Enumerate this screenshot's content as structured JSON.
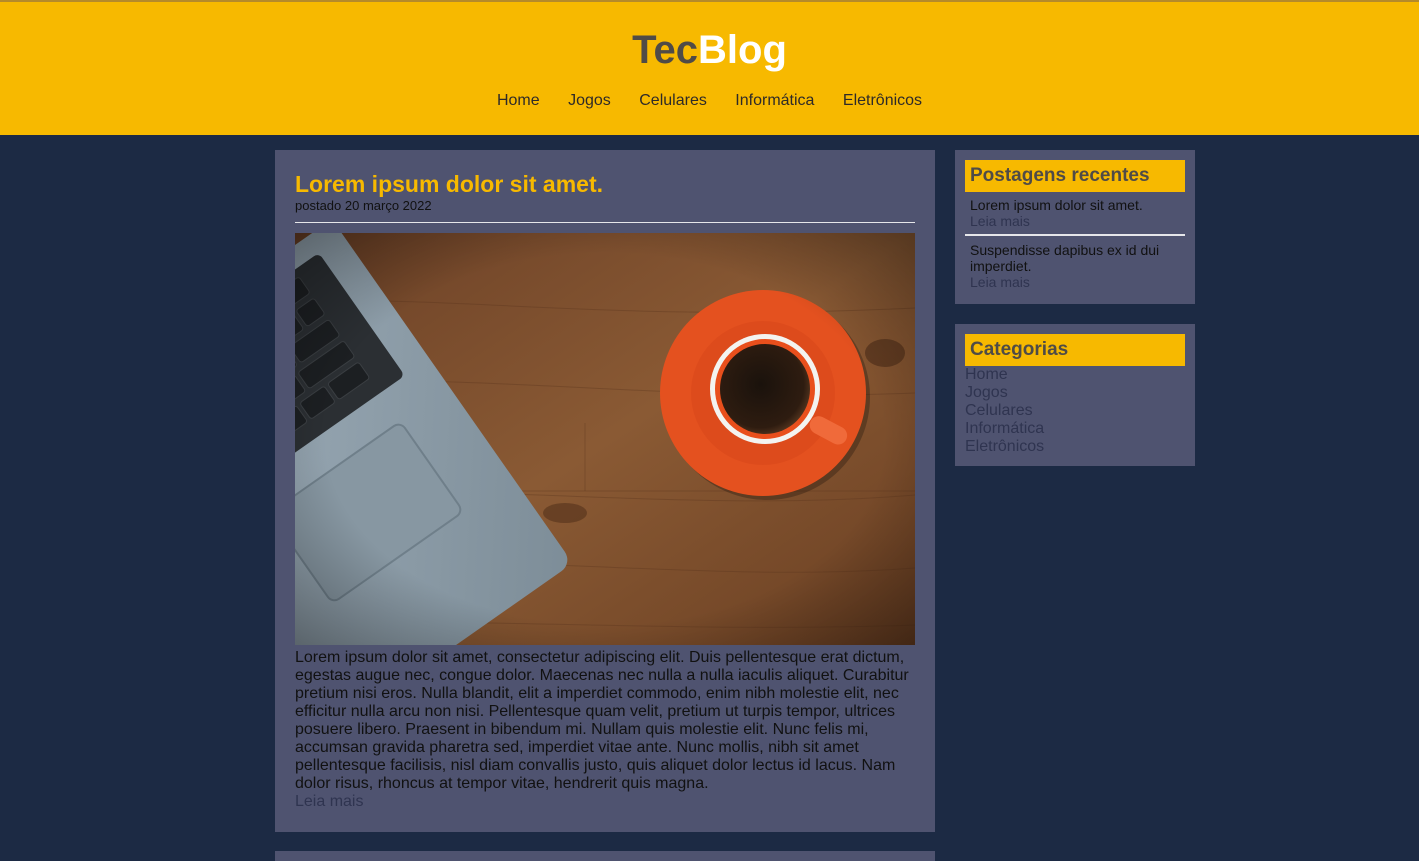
{
  "header": {
    "logo_part1": "Tec",
    "logo_part2": "Blog",
    "nav": [
      "Home",
      "Jogos",
      "Celulares",
      "Informática",
      "Eletrônicos"
    ]
  },
  "post": {
    "title": "Lorem ipsum dolor sit amet.",
    "date": "postado 20 março 2022",
    "body": "Lorem ipsum dolor sit amet, consectetur adipiscing elit. Duis pellentesque erat dictum, egestas augue nec, congue dolor. Maecenas nec nulla a nulla iaculis aliquet. Curabitur pretium nisi eros. Nulla blandit, elit a imperdiet commodo, enim nibh molestie elit, nec efficitur nulla arcu non nisi. Pellentesque quam velit, pretium ut turpis tempor, ultrices posuere libero. Praesent in bibendum mi. Nullam quis molestie elit. Nunc felis mi, accumsan gravida pharetra sed, imperdiet vitae ante. Nunc mollis, nibh sit amet pellentesque facilisis, nisl diam convallis justo, quis aliquet dolor lectus id lacus. Nam dolor risus, rhoncus at tempor vitae, hendrerit quis magna.",
    "read_more": "Leia mais",
    "image": "laptop-and-coffee-cup-on-wood-desk"
  },
  "recent": {
    "title": "Postagens recentes",
    "items": [
      {
        "title": "Lorem ipsum dolor sit amet.",
        "more": "Leia mais"
      },
      {
        "title": "Suspendisse dapibus ex id dui imperdiet.",
        "more": "Leia mais"
      }
    ]
  },
  "categories": {
    "title": "Categorias",
    "items": [
      "Home",
      "Jogos",
      "Celulares",
      "Informática",
      "Eletrônicos"
    ]
  },
  "colors": {
    "accent": "#f7b900",
    "background": "#1c2a44",
    "panel": "#4f5370"
  }
}
